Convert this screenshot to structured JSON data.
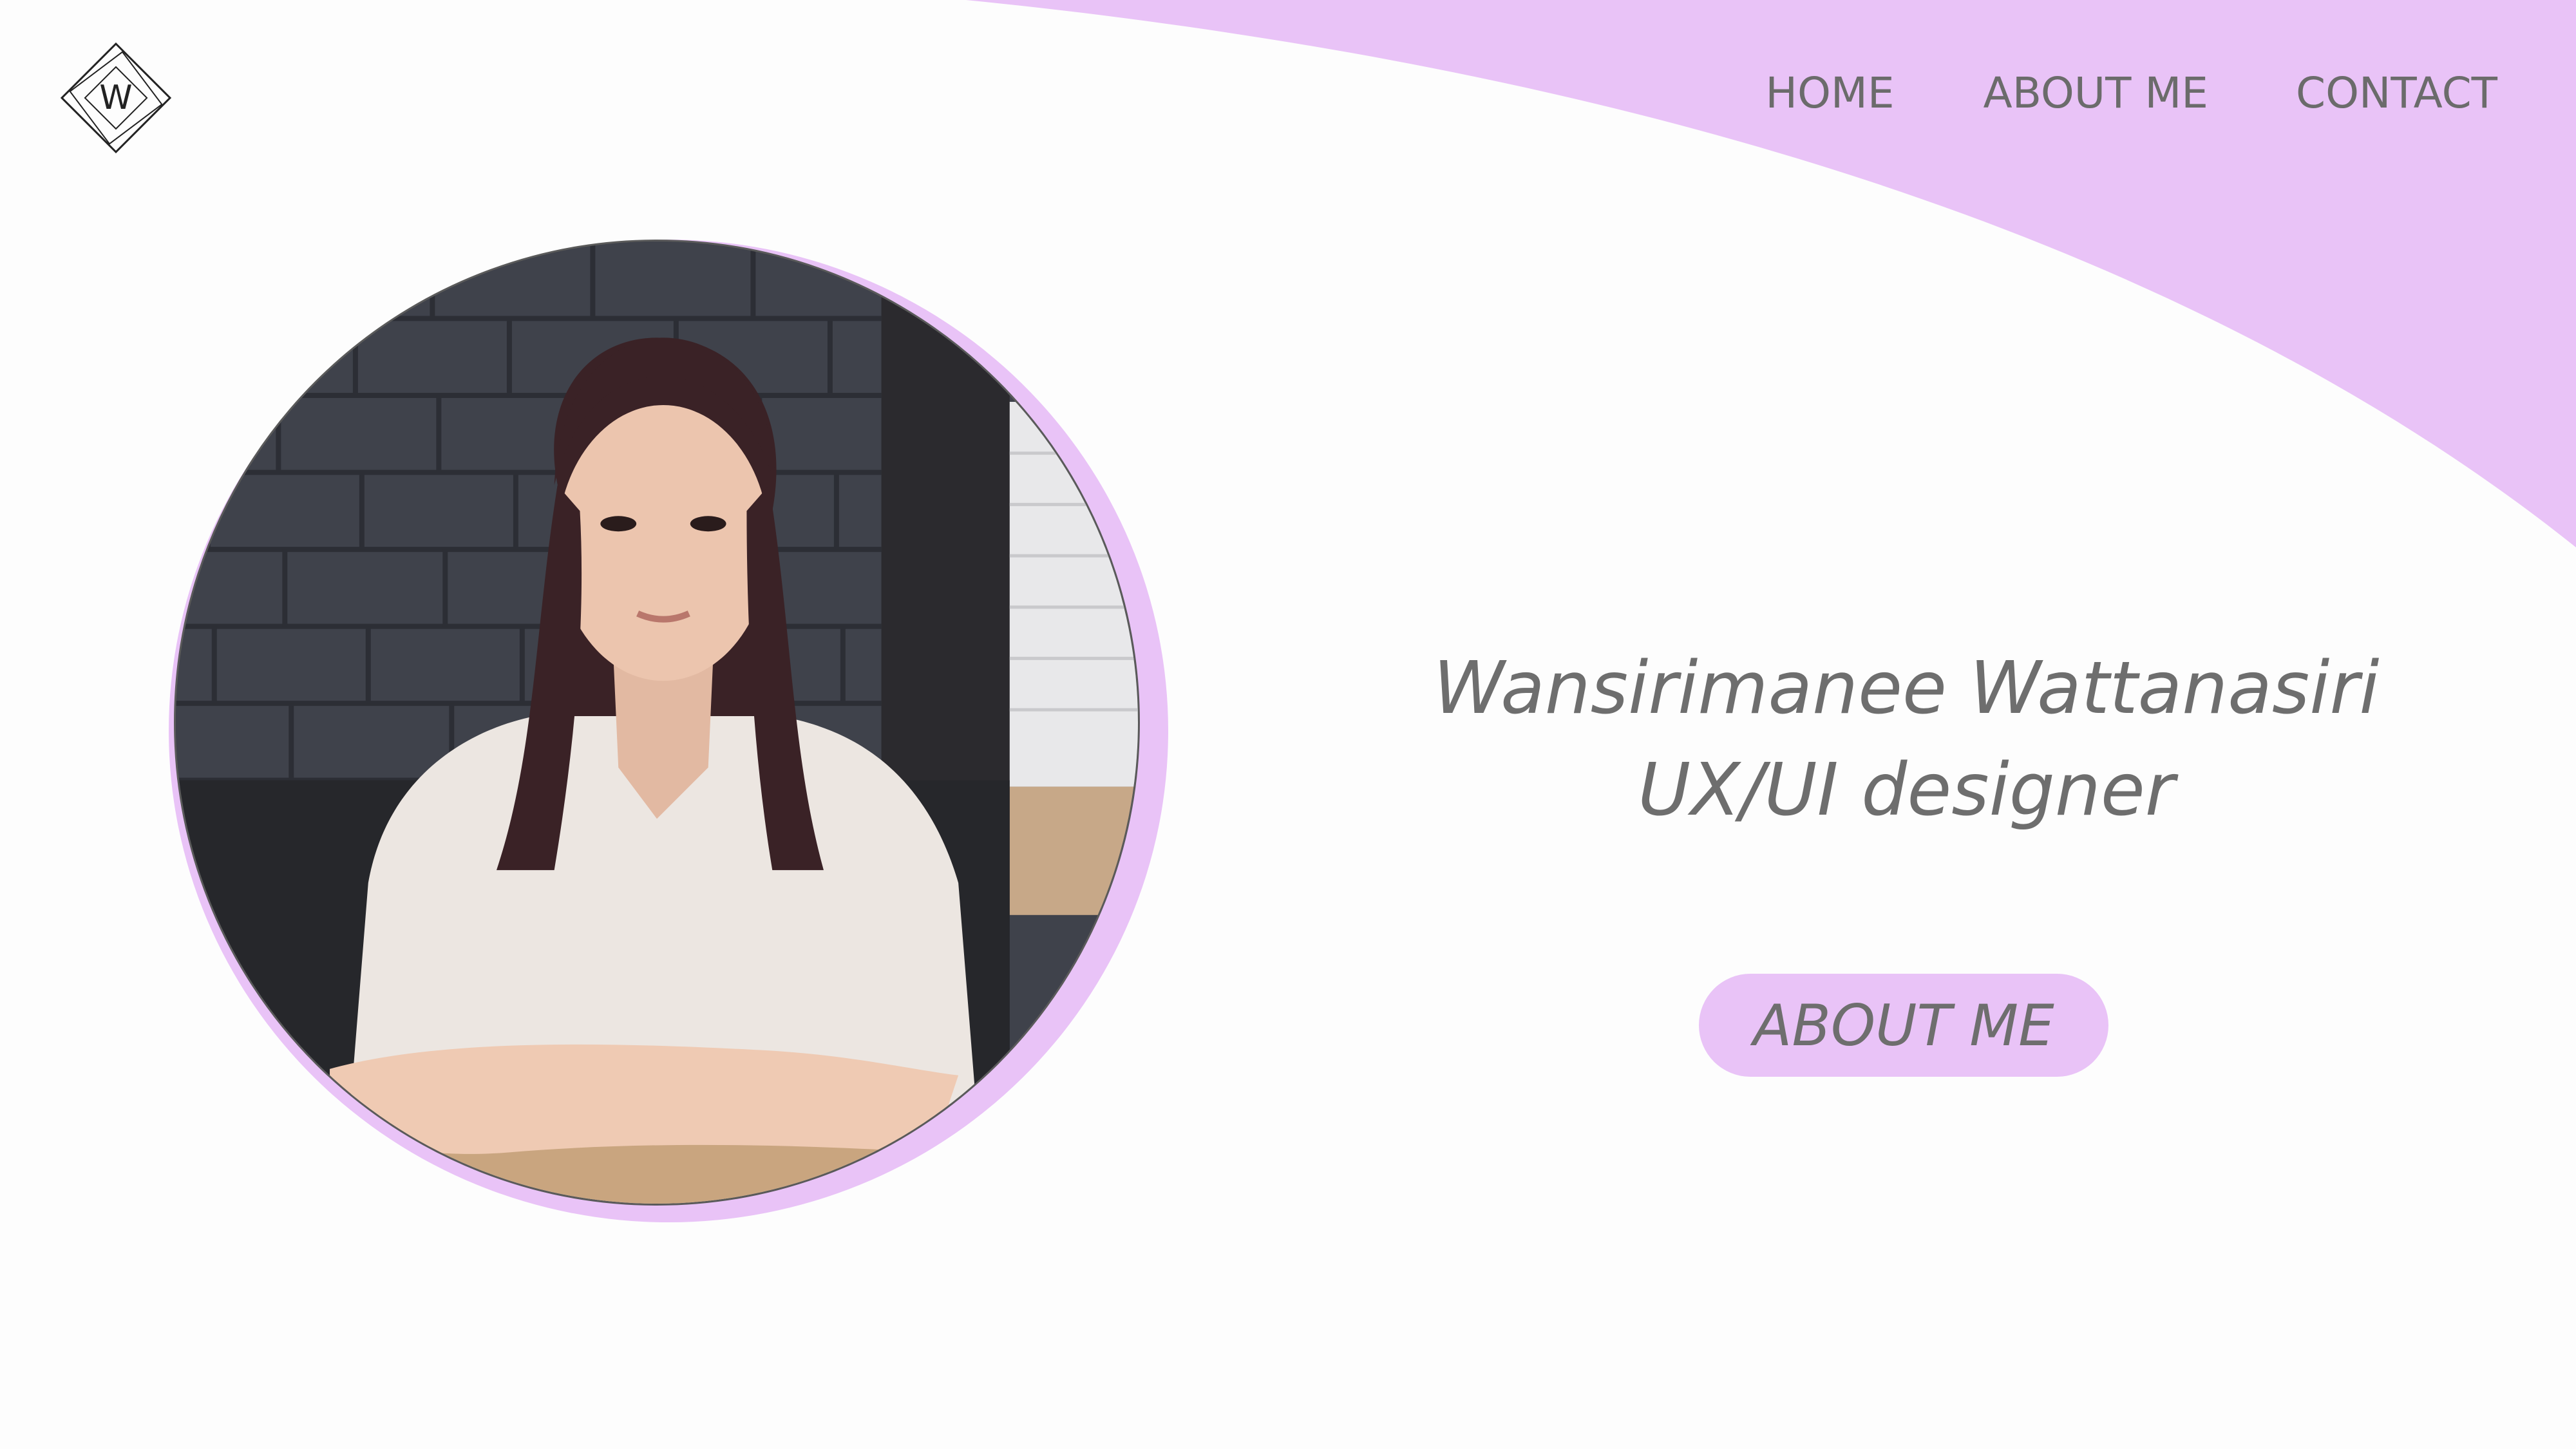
{
  "brand": {
    "logo_letter": "W",
    "logo_icon": "diamond-monogram-logo"
  },
  "nav": {
    "items": [
      {
        "label": "HOME"
      },
      {
        "label": "ABOUT ME"
      },
      {
        "label": "CONTACT"
      }
    ]
  },
  "hero": {
    "name": "Wansirimanee Wattanasiri",
    "role": "UX/UI designer",
    "cta_label": "ABOUT ME",
    "photo_icon": "profile-photo"
  },
  "colors": {
    "accent": "#e9c3f7",
    "text": "#6e6e6e",
    "background": "#fdfdfd"
  }
}
